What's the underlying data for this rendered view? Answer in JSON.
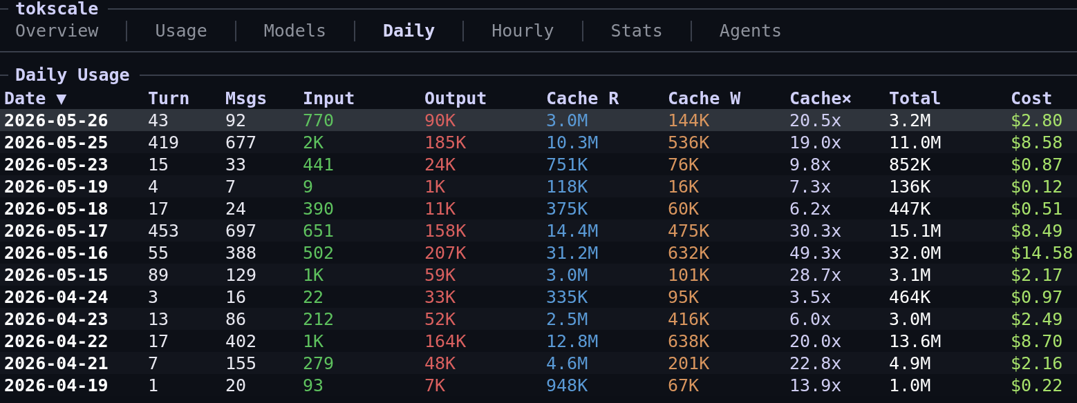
{
  "app_title": "tokscale",
  "tabs": [
    {
      "label": "Overview",
      "selected": false
    },
    {
      "label": "Usage",
      "selected": false
    },
    {
      "label": "Models",
      "selected": false
    },
    {
      "label": "Daily",
      "selected": true
    },
    {
      "label": "Hourly",
      "selected": false
    },
    {
      "label": "Stats",
      "selected": false
    },
    {
      "label": "Agents",
      "selected": false
    }
  ],
  "panel_title": "Daily Usage",
  "table": {
    "columns": [
      "Date ▼",
      "Turn",
      "Msgs",
      "Input",
      "Output",
      "Cache R",
      "Cache W",
      "Cache×",
      "Total",
      "Cost"
    ],
    "rows": [
      {
        "selected": true,
        "cells": [
          "2026-05-26",
          "43",
          "92",
          "770",
          "90K",
          "3.0M",
          "144K",
          "20.5x",
          "3.2M",
          "$2.80"
        ]
      },
      {
        "selected": false,
        "cells": [
          "2026-05-25",
          "419",
          "677",
          "2K",
          "185K",
          "10.3M",
          "536K",
          "19.0x",
          "11.0M",
          "$8.58"
        ]
      },
      {
        "selected": false,
        "cells": [
          "2026-05-23",
          "15",
          "33",
          "441",
          "24K",
          "751K",
          "76K",
          "9.8x",
          "852K",
          "$0.87"
        ]
      },
      {
        "selected": false,
        "cells": [
          "2026-05-19",
          "4",
          "7",
          "9",
          "1K",
          "118K",
          "16K",
          "7.3x",
          "136K",
          "$0.12"
        ]
      },
      {
        "selected": false,
        "cells": [
          "2026-05-18",
          "17",
          "24",
          "390",
          "11K",
          "375K",
          "60K",
          "6.2x",
          "447K",
          "$0.51"
        ]
      },
      {
        "selected": false,
        "cells": [
          "2026-05-17",
          "453",
          "697",
          "651",
          "158K",
          "14.4M",
          "475K",
          "30.3x",
          "15.1M",
          "$8.49"
        ]
      },
      {
        "selected": false,
        "cells": [
          "2026-05-16",
          "55",
          "388",
          "502",
          "207K",
          "31.2M",
          "632K",
          "49.3x",
          "32.0M",
          "$14.58"
        ]
      },
      {
        "selected": false,
        "cells": [
          "2026-05-15",
          "89",
          "129",
          "1K",
          "59K",
          "3.0M",
          "101K",
          "28.7x",
          "3.1M",
          "$2.17"
        ]
      },
      {
        "selected": false,
        "cells": [
          "2026-04-24",
          "3",
          "16",
          "22",
          "33K",
          "335K",
          "95K",
          "3.5x",
          "464K",
          "$0.97"
        ]
      },
      {
        "selected": false,
        "cells": [
          "2026-04-23",
          "13",
          "86",
          "212",
          "52K",
          "2.5M",
          "416K",
          "6.0x",
          "3.0M",
          "$2.49"
        ]
      },
      {
        "selected": false,
        "cells": [
          "2026-04-22",
          "17",
          "402",
          "1K",
          "164K",
          "12.8M",
          "638K",
          "20.0x",
          "13.6M",
          "$8.70"
        ]
      },
      {
        "selected": false,
        "cells": [
          "2026-04-21",
          "7",
          "155",
          "279",
          "48K",
          "4.6M",
          "201K",
          "22.8x",
          "4.9M",
          "$2.16"
        ]
      },
      {
        "selected": false,
        "cells": [
          "2026-04-19",
          "1",
          "20",
          "93",
          "7K",
          "948K",
          "67K",
          "13.9x",
          "1.0M",
          "$0.22"
        ]
      }
    ]
  }
}
